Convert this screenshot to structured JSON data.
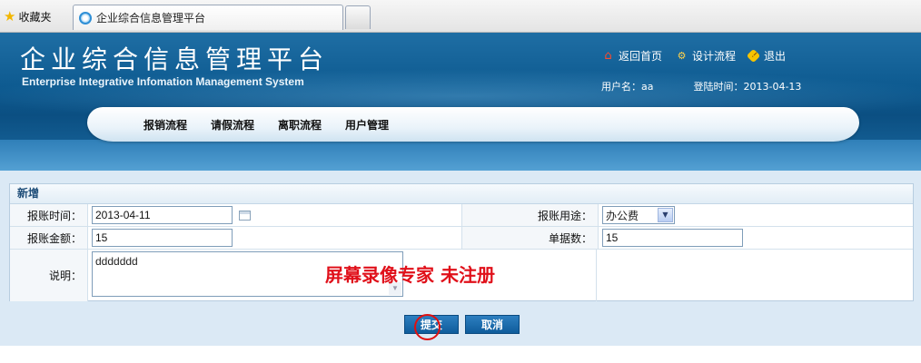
{
  "browser": {
    "favorites_label": "收藏夹",
    "tab_title": "企业综合信息管理平台"
  },
  "header": {
    "title_cn": "企业综合信息管理平台",
    "title_en": "Enterprise Integrative Infomation Management System",
    "links": {
      "home": "返回首页",
      "design_flow": "设计流程",
      "logout": "退出"
    },
    "user_label": "用户名：aa",
    "login_time": "登陆时间：2013-04-13"
  },
  "nav": {
    "items": [
      "报销流程",
      "请假流程",
      "离职流程",
      "用户管理"
    ]
  },
  "form": {
    "panel_title": "新增",
    "labels": {
      "date": "报账时间：",
      "purpose": "报账用途：",
      "amount": "报账金额：",
      "docs": "单据数：",
      "note": "说明："
    },
    "values": {
      "date": "2013-04-11",
      "purpose": "办公费",
      "amount": "15",
      "docs": "15",
      "note": "ddddddd"
    }
  },
  "watermark": "屏幕录像专家  未注册",
  "buttons": {
    "submit": "提交",
    "cancel": "取消"
  },
  "icons": {
    "favorites": "star-icon",
    "tab": "browser-tab-icon",
    "home": "home-icon",
    "flow": "flow-icon",
    "logout": "logout-icon",
    "calendar": "calendar-icon",
    "dropdown": "chevron-down-icon"
  }
}
